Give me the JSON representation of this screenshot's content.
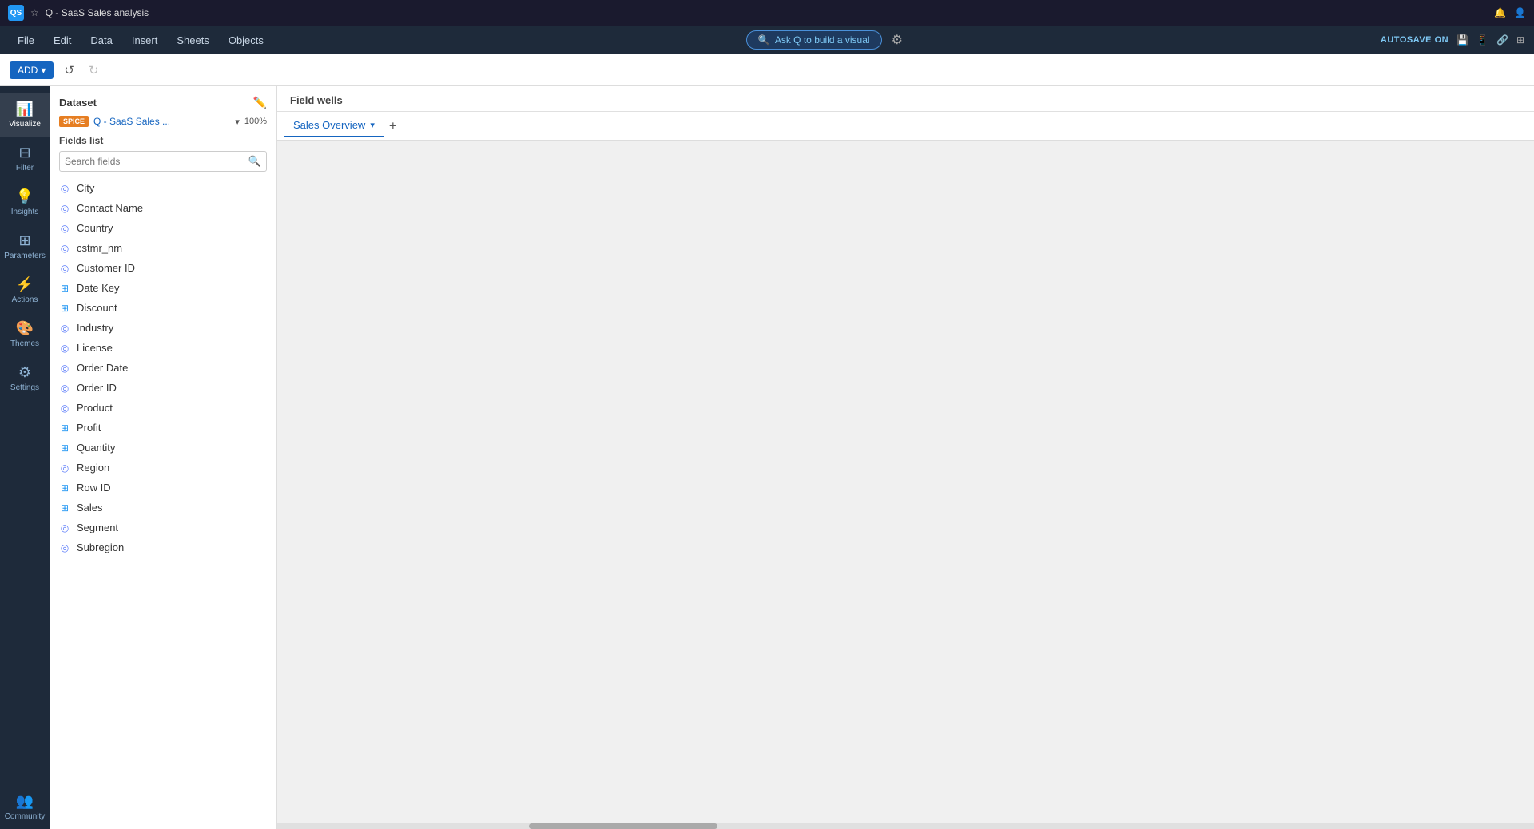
{
  "titlebar": {
    "logo": "QS",
    "star": "☆",
    "title": "Q - SaaS Sales analysis",
    "icons": [
      "🔔",
      "👤"
    ]
  },
  "menubar": {
    "items": [
      "File",
      "Edit",
      "Data",
      "Insert",
      "Sheets",
      "Objects"
    ],
    "ask_q_label": "Ask Q to build a visual",
    "gear_icon": "⚙",
    "autosave_label": "AUTOSAVE ON",
    "right_icons": [
      "💾",
      "📱",
      "🔗",
      "⊞"
    ]
  },
  "toolbar": {
    "add_label": "ADD",
    "add_chevron": "▾",
    "undo_icon": "↺",
    "redo_icon": "↻"
  },
  "sidebar": {
    "items": [
      {
        "id": "visualize",
        "label": "Visualize",
        "icon": "📊",
        "active": true
      },
      {
        "id": "filter",
        "label": "Filter",
        "icon": "⊟"
      },
      {
        "id": "insights",
        "label": "Insights",
        "icon": "💡"
      },
      {
        "id": "parameters",
        "label": "Parameters",
        "icon": "⊞"
      },
      {
        "id": "actions",
        "label": "Actions",
        "icon": "⚡"
      },
      {
        "id": "themes",
        "label": "Themes",
        "icon": "🎨"
      },
      {
        "id": "settings",
        "label": "Settings",
        "icon": "⚙"
      }
    ],
    "bottom_items": [
      {
        "id": "community",
        "label": "Community",
        "icon": "👥"
      }
    ]
  },
  "dataset": {
    "header": "Dataset",
    "spice_label": "SPICE",
    "name": "Q - SaaS Sales ...",
    "percent": "100%"
  },
  "fields_list": {
    "header": "Fields list",
    "search_placeholder": "Search fields",
    "items": [
      {
        "name": "City",
        "type": "string"
      },
      {
        "name": "Contact Name",
        "type": "string"
      },
      {
        "name": "Country",
        "type": "string"
      },
      {
        "name": "cstmr_nm",
        "type": "string"
      },
      {
        "name": "Customer ID",
        "type": "string"
      },
      {
        "name": "Date Key",
        "type": "number"
      },
      {
        "name": "Discount",
        "type": "number"
      },
      {
        "name": "Industry",
        "type": "string"
      },
      {
        "name": "License",
        "type": "string"
      },
      {
        "name": "Order Date",
        "type": "date"
      },
      {
        "name": "Order ID",
        "type": "string"
      },
      {
        "name": "Product",
        "type": "string"
      },
      {
        "name": "Profit",
        "type": "number"
      },
      {
        "name": "Quantity",
        "type": "number"
      },
      {
        "name": "Region",
        "type": "string"
      },
      {
        "name": "Row ID",
        "type": "number"
      },
      {
        "name": "Sales",
        "type": "number"
      },
      {
        "name": "Segment",
        "type": "string"
      },
      {
        "name": "Subregion",
        "type": "string"
      }
    ]
  },
  "canvas": {
    "field_wells_label": "Field wells",
    "sheet_tab_label": "Sales Overview",
    "add_sheet_icon": "+"
  },
  "icons": {
    "string_icon": "◎",
    "number_icon": "⊞",
    "date_icon": "◎"
  }
}
